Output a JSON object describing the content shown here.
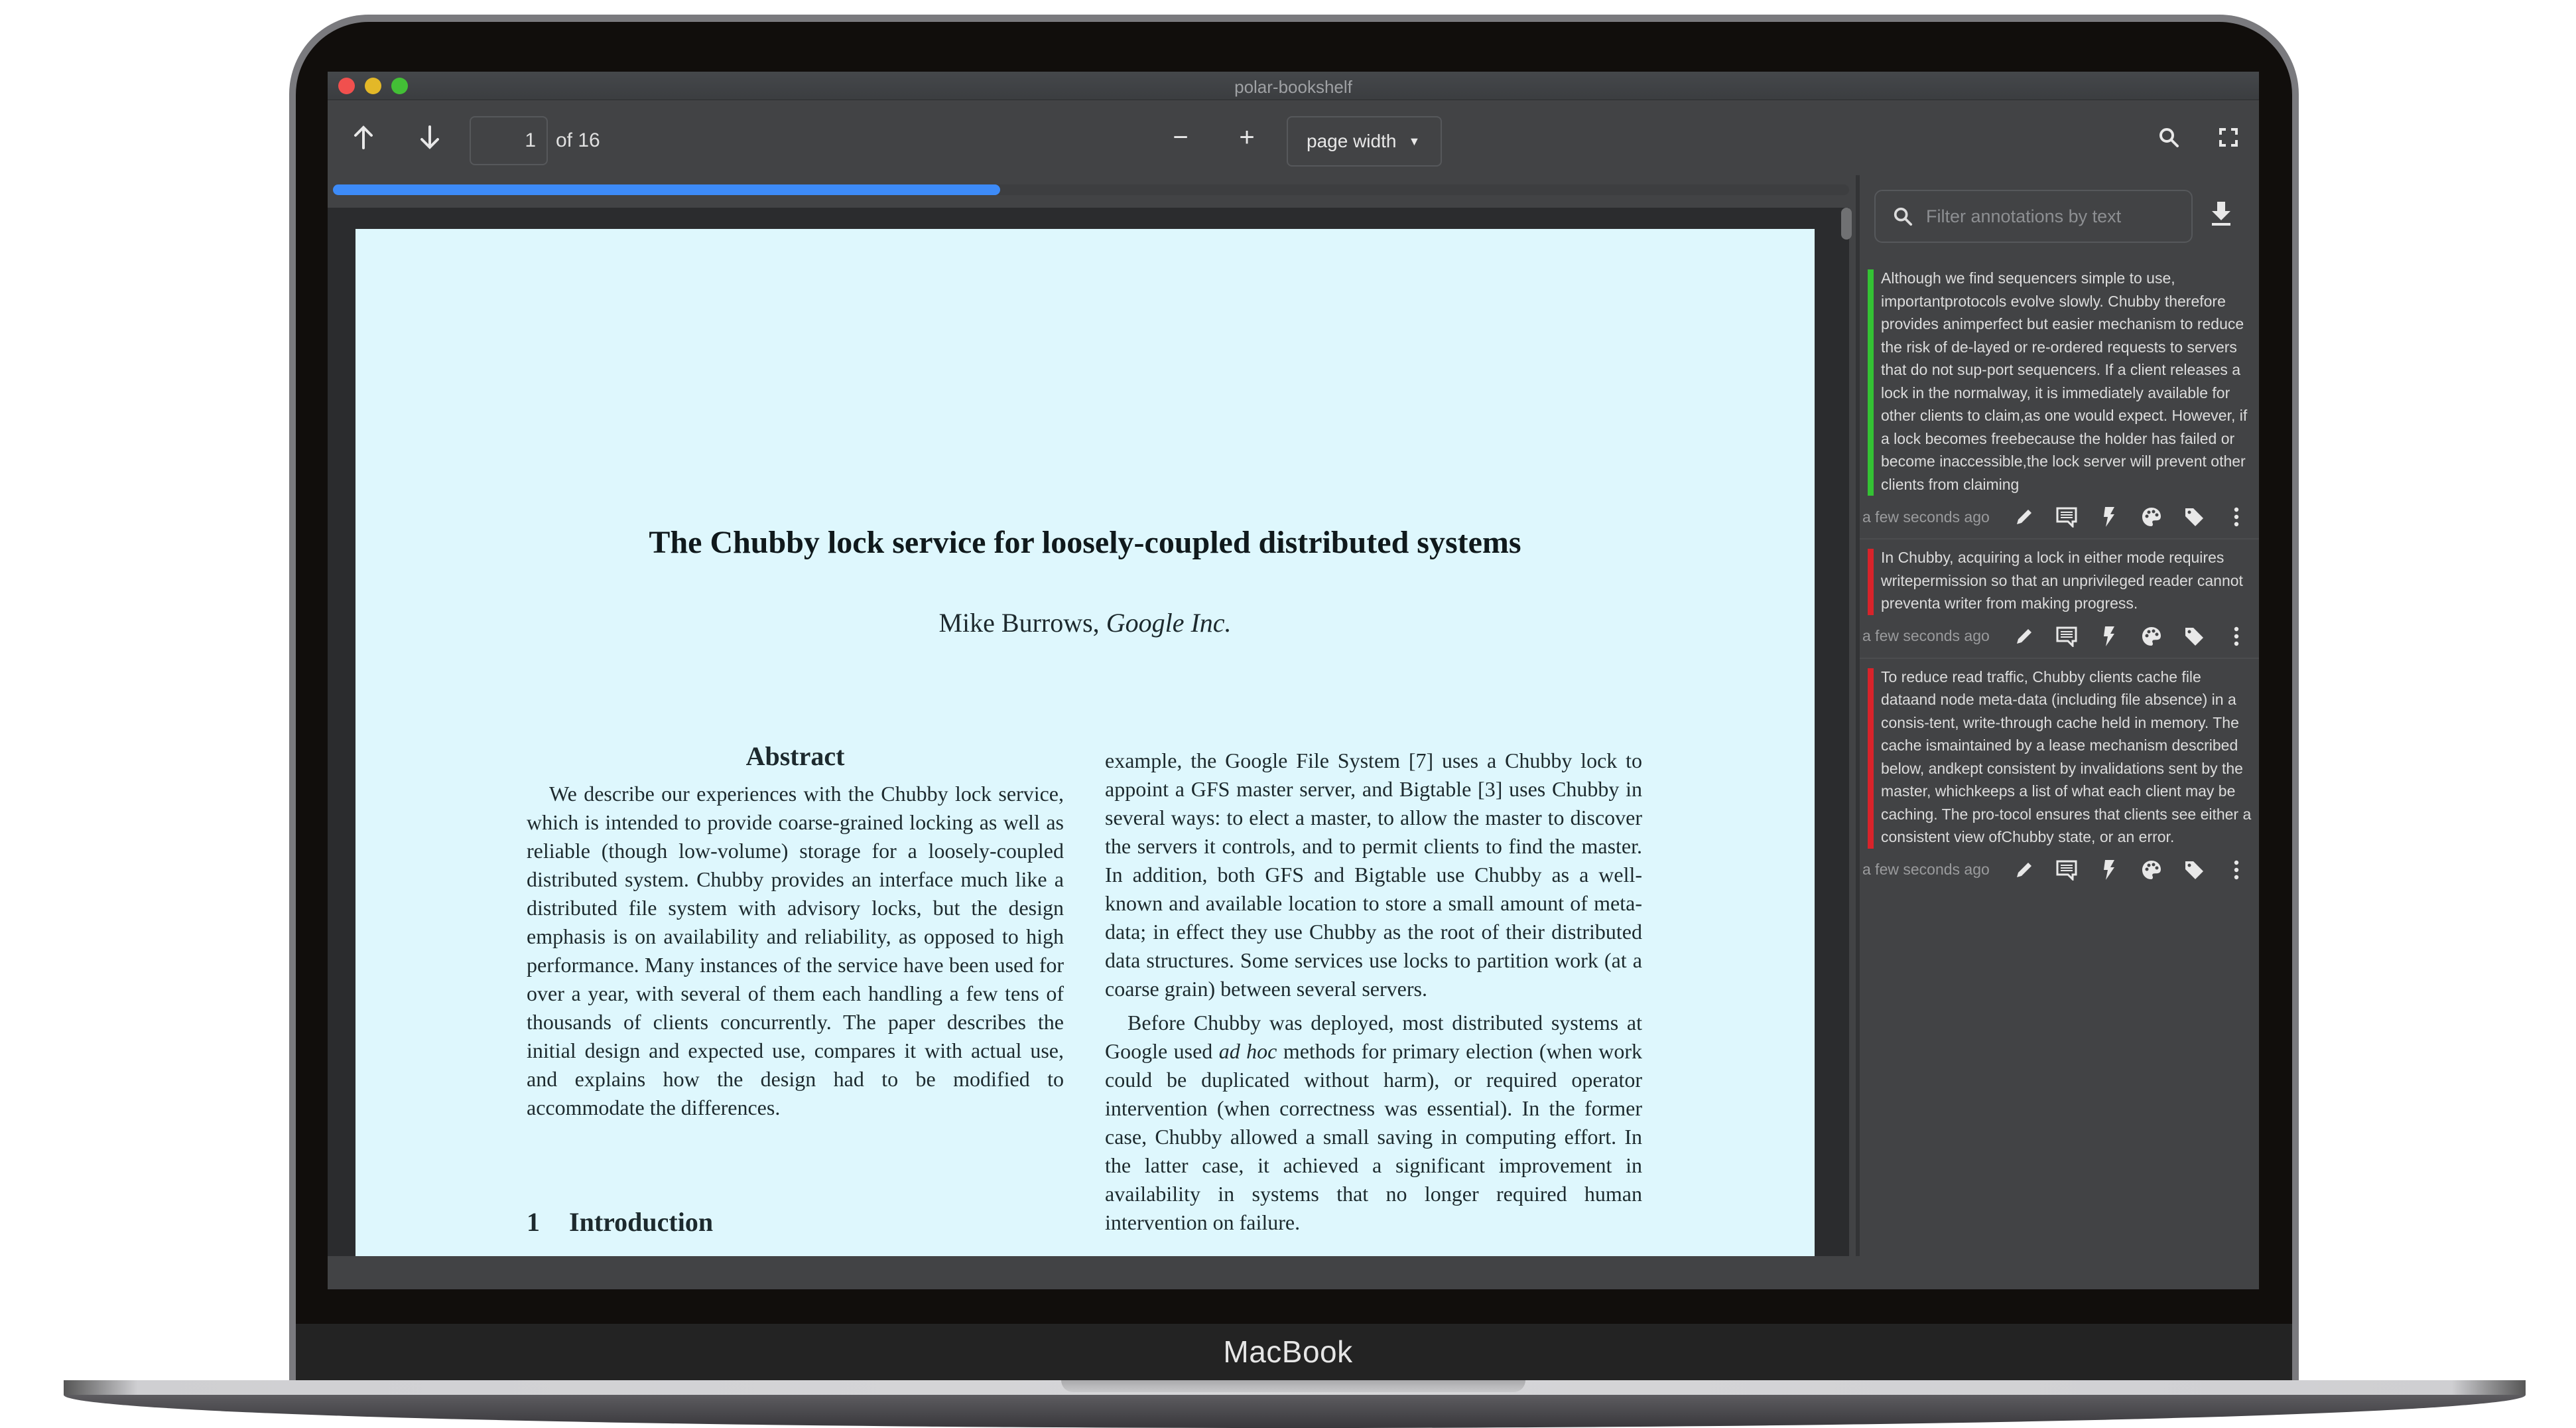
{
  "device": {
    "label": "MacBook"
  },
  "window": {
    "title": "polar-bookshelf",
    "traffic_lights": {
      "close": "#f1504e",
      "minimize": "#e3b828",
      "zoom": "#43bf36"
    }
  },
  "toolbar": {
    "prev_page_icon": "arrow-up-icon",
    "next_page_icon": "arrow-down-icon",
    "page_number": "1",
    "page_total_label": "of 16",
    "zoom_out_label": "−",
    "zoom_in_label": "+",
    "zoom_mode": "page width",
    "search_icon": "search-icon",
    "fullscreen_icon": "fullscreen-icon"
  },
  "progress": {
    "fraction": 0.44,
    "color": "#3d8bf8"
  },
  "document": {
    "title": "The Chubby lock service for loosely-coupled distributed systems",
    "author": "Mike Burrows,",
    "affiliation": "Google Inc.",
    "abstract_heading": "Abstract",
    "abstract_text": "We describe our experiences with the Chubby lock service, which is intended to provide coarse-grained locking as well as reliable (though low-volume) storage for a loosely-coupled distributed system. Chubby provides an interface much like a distributed file system with advisory locks, but the design emphasis is on availability and reliability, as opposed to high performance. Many instances of the service have been used for over a year, with several of them each handling a few tens of thousands of clients concurrently. The paper describes the initial design and expected use, compares it with actual use, and explains how the design had to be modified to accommodate the differences.",
    "section_number": "1",
    "section_title": "Introduction",
    "right_col_p1": "example, the Google File System [7] uses a Chubby lock to appoint a GFS master server, and Bigtable [3] uses Chubby in several ways: to elect a master, to allow the master to discover the servers it controls, and to permit clients to find the master. In addition, both GFS and Bigtable use Chubby as a well-known and available location to store a small amount of meta-data; in effect they use Chubby as the root of their distributed data structures. Some services use locks to partition work (at a coarse grain) between several servers.",
    "right_col_p2_before": "Before Chubby was deployed, most distributed systems at Google used",
    "right_col_p2_italic": "ad hoc",
    "right_col_p2_after": "methods for primary election (when work could be duplicated without harm), or required operator intervention (when correctness was essential). In the former case, Chubby allowed a small saving in computing effort. In the latter case, it achieved a significant improvement in availability in systems that no longer required human intervention on failure."
  },
  "sidebar": {
    "filter_placeholder": "Filter annotations by text",
    "filter_value": "",
    "download_icon": "download-icon",
    "annotations": [
      {
        "color": "#34c234",
        "text": "Although we find sequencers simple to use, importantprotocols evolve slowly. Chubby therefore provides animperfect but easier mechanism to reduce the risk of de-layed or re-ordered requests to servers that do not sup-port sequencers. If a client releases a lock in the normalway, it is immediately available for other clients to claim,as one would expect. However, if a lock becomes freebecause the holder has failed or become inaccessible,the lock server will prevent other clients from claiming",
        "time": "a few seconds ago"
      },
      {
        "color": "#d8232a",
        "text": "In Chubby, acquiring a lock in either mode requires writepermission so that an unprivileged reader cannot preventa writer from making progress.",
        "time": "a few seconds ago"
      },
      {
        "color": "#d8232a",
        "text": "To reduce read traffic, Chubby clients cache file dataand node meta-data (including file absence) in a consis-tent, write-through cache held in memory. The cache ismaintained by a lease mechanism described below, andkept consistent by invalidations sent by the master, whichkeeps a list of what each client may be caching. The pro-tocol ensures that clients see either a consistent view ofChubby state, or an error.",
        "time": "a few seconds ago"
      }
    ],
    "annotation_actions": [
      "edit-icon",
      "comment-icon",
      "flashcard-icon",
      "color-palette-icon",
      "tag-icon",
      "more-options-icon"
    ]
  }
}
